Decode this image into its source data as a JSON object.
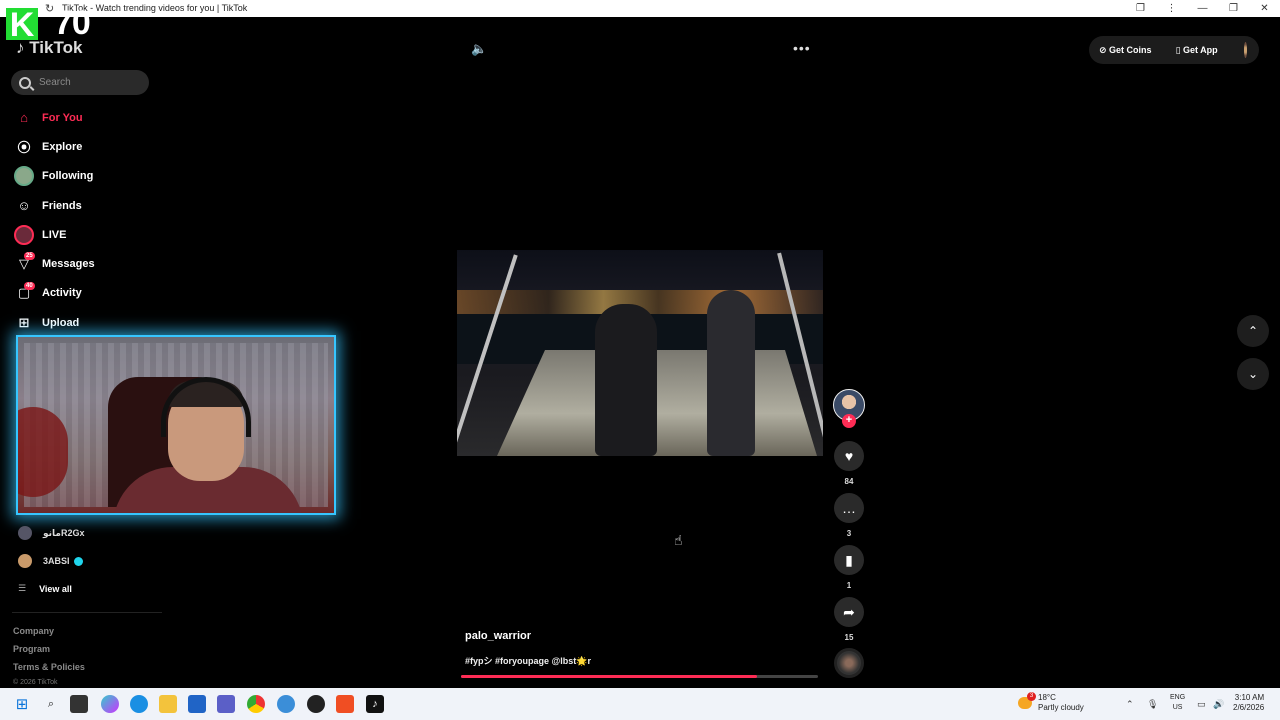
{
  "browser": {
    "tab_title": "TikTok - Watch trending videos for you | TikTok",
    "controls": [
      "❐",
      "⋮",
      "—",
      "❐",
      "✕"
    ]
  },
  "overlay": {
    "letter": "K",
    "count": "70"
  },
  "logo": "TikTok",
  "search": {
    "placeholder": "Search"
  },
  "nav": [
    {
      "label": "For You",
      "icon": "home-icon",
      "glyph": "⌂"
    },
    {
      "label": "Explore",
      "icon": "compass-icon",
      "glyph": "⦿"
    },
    {
      "label": "Following",
      "icon": "following-avatar-icon",
      "glyph": "◉"
    },
    {
      "label": "Friends",
      "icon": "friends-icon",
      "glyph": "☺"
    },
    {
      "label": "LIVE",
      "icon": "live-icon",
      "glyph": "●"
    },
    {
      "label": "Messages",
      "icon": "messages-icon",
      "glyph": "▽",
      "badge": "25"
    },
    {
      "label": "Activity",
      "icon": "activity-icon",
      "glyph": "▢",
      "badge": "40"
    },
    {
      "label": "Upload",
      "icon": "upload-icon",
      "glyph": "⊞"
    }
  ],
  "following_accounts": [
    {
      "name": "مانوR2Gx"
    },
    {
      "name": "3ABSI"
    }
  ],
  "view_all": "View all",
  "footer": {
    "links": [
      "Company",
      "Program",
      "Terms & Policies"
    ],
    "copyright": "© 2026 TikTok"
  },
  "topbar": {
    "get_coins": "Get Coins",
    "get_app": "Get App"
  },
  "video": {
    "author": "palo_warrior",
    "caption": "#fypシ #foryoupage @lbst🌟r",
    "progress": 0.83
  },
  "actions": {
    "likes": "84",
    "comments": "3",
    "saves": "1",
    "shares": "15"
  },
  "taskbar": {
    "weather_temp": "18°C",
    "weather_desc": "Partly cloudy",
    "weather_badge": "3",
    "lang_top": "ENG",
    "lang_bottom": "US",
    "time": "3:10 AM",
    "date": "2/6/2026"
  },
  "colors": {
    "accent": "#fe2c55",
    "webcam_border": "#37c6ff"
  }
}
